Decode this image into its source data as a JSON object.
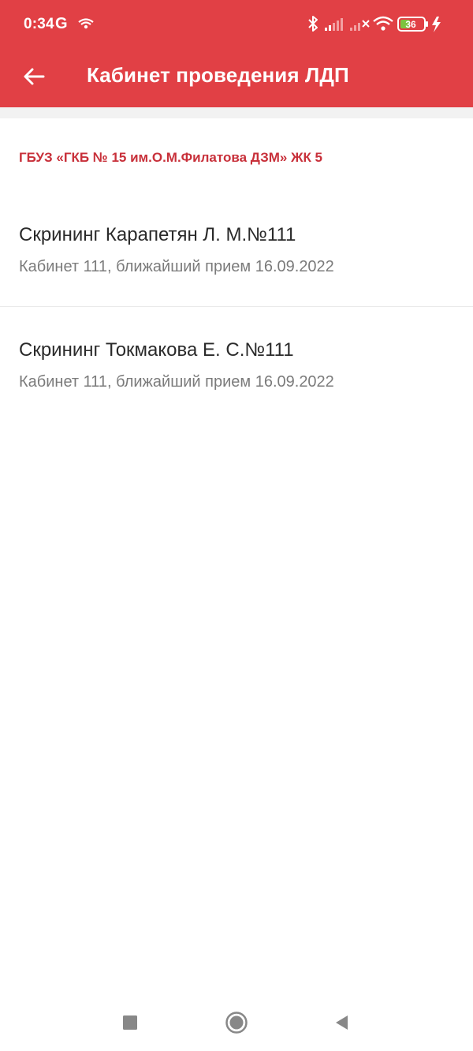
{
  "status_bar": {
    "time": "0:34",
    "carrier_letter": "G",
    "battery_level": "36"
  },
  "app_bar": {
    "title": "Кабинет проведения ЛДП"
  },
  "section": {
    "header": "ГБУЗ «ГКБ № 15 им.О.М.Филатова ДЗМ» ЖК 5"
  },
  "items": [
    {
      "title": "Скрининг Карапетян Л. М.№111",
      "subtitle": "Кабинет 111, ближайший прием 16.09.2022"
    },
    {
      "title": "Скрининг Токмакова Е. С.№111",
      "subtitle": "Кабинет 111, ближайший прием 16.09.2022"
    }
  ],
  "colors": {
    "primary": "#e14045",
    "section_header": "#c8303a",
    "battery_fill": "#7cc43f"
  },
  "icons": {
    "back": "arrow-left-icon",
    "nav_recents": "square-icon",
    "nav_home": "circle-icon",
    "nav_back": "triangle-left-icon"
  }
}
